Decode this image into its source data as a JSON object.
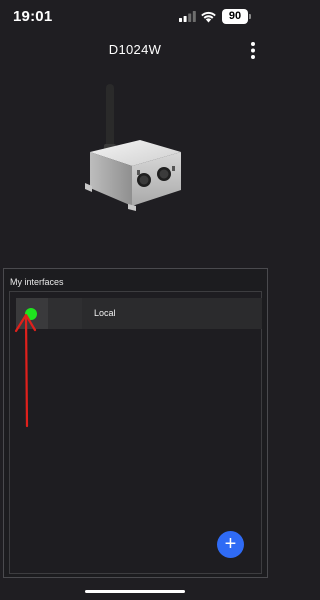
{
  "status_bar": {
    "time": "19:01",
    "battery_level": "90"
  },
  "header": {
    "title": "D1024W",
    "menu_icon": "more-vertical-icon"
  },
  "interfaces": {
    "section_title": "My interfaces",
    "items": [
      {
        "label": "Local",
        "status_color": "#1fe31f"
      }
    ],
    "add_icon": "+"
  },
  "colors": {
    "accent": "#2f6bf5",
    "status_online": "#1fe31f",
    "annotation": "#e0201c",
    "background": "#1f1e22"
  }
}
